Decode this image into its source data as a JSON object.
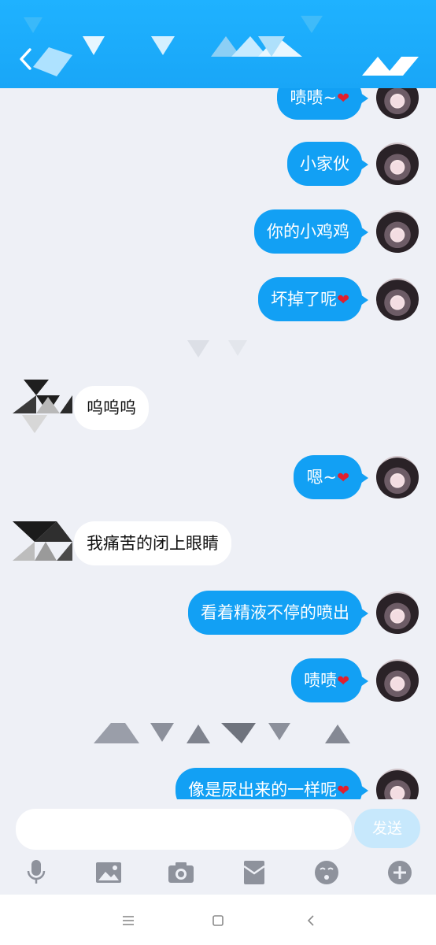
{
  "messages": [
    {
      "side": "out",
      "text": "啧啧~",
      "heart": true
    },
    {
      "side": "out",
      "text": "小家伙",
      "heart": false
    },
    {
      "side": "out",
      "text": "你的小鸡鸡",
      "heart": false
    },
    {
      "side": "out",
      "text": "坏掉了呢",
      "heart": true
    },
    {
      "side": "in",
      "text": "呜呜呜",
      "heart": false
    },
    {
      "side": "out",
      "text": "嗯~",
      "heart": true
    },
    {
      "side": "in",
      "text": "我痛苦的闭上眼睛",
      "heart": false
    },
    {
      "side": "out",
      "text": "看着精液不停的喷出",
      "heart": false
    },
    {
      "side": "out",
      "text": "啧啧",
      "heart": true
    },
    {
      "side": "out",
      "text": "像是尿出来的一样呢",
      "heart": true
    }
  ],
  "heart_glyph": "❤",
  "input": {
    "placeholder": ""
  },
  "send_label": "发送",
  "toolbar": [
    "microphone-icon",
    "image-icon",
    "camera-icon",
    "red-packet-icon",
    "emoji-icon",
    "plus-icon"
  ],
  "colors": {
    "header": "#1fb2ff",
    "bubble_out": "#12a0f4",
    "send_disabled": "#c7e8fc"
  }
}
